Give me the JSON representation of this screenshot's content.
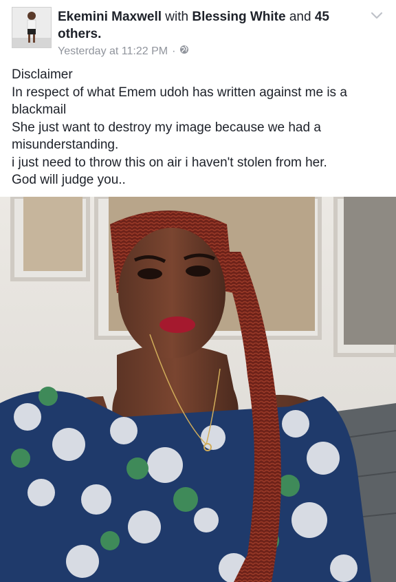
{
  "post": {
    "author": "Ekemini Maxwell",
    "with_word": "with",
    "tagged": "Blessing White",
    "and_word": "and",
    "others": "45 others.",
    "timestamp": "Yesterday at 11:22 PM",
    "separator": "·",
    "privacy_icon": "globe-icon",
    "options_icon": "chevron-down-icon",
    "text_lines": [
      "Disclaimer",
      "In respect of what Emem udoh has written against me is a",
      "blackmail",
      "She just want to destroy my image because we had a",
      "misunderstanding.",
      "i just need to throw this on air i haven't stolen from her.",
      "God will judge you.."
    ]
  },
  "colors": {
    "text": "#1d2129",
    "meta": "#90949c",
    "background": "#ffffff"
  }
}
